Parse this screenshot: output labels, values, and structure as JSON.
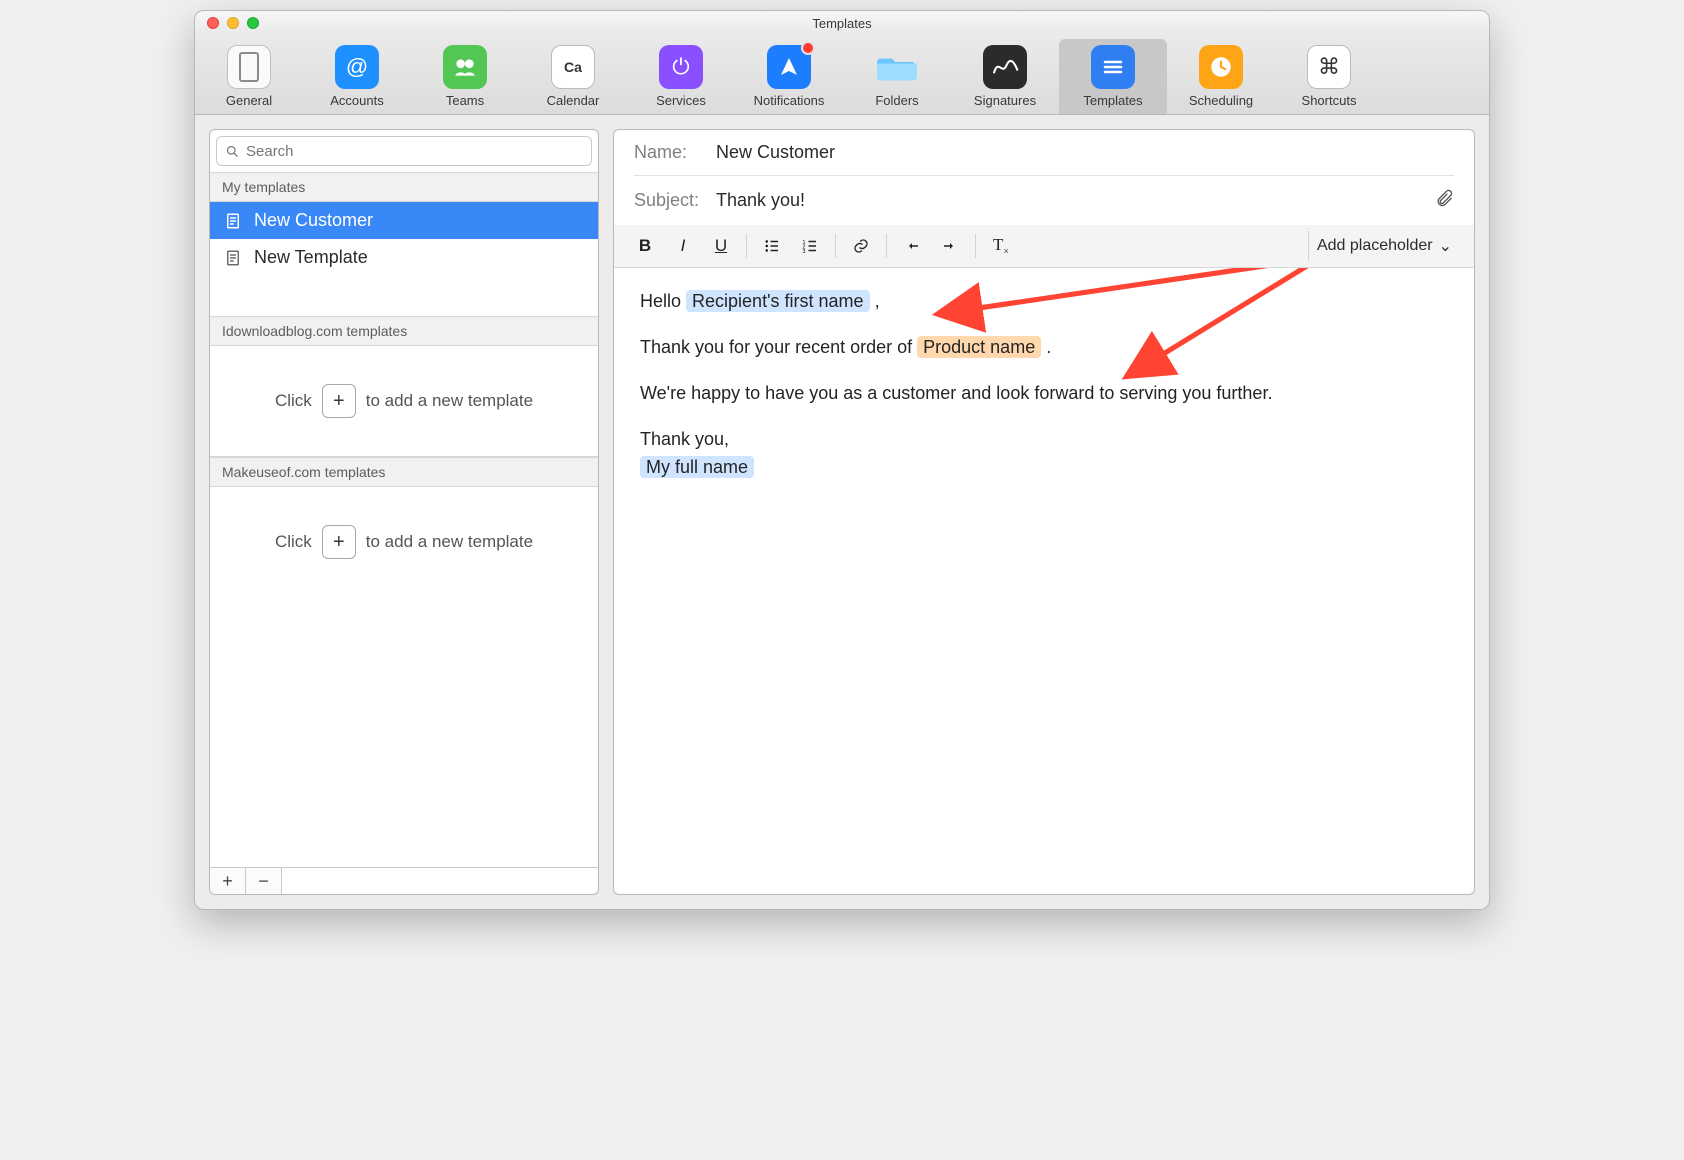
{
  "window": {
    "title": "Templates"
  },
  "toolbar": {
    "items": [
      {
        "label": "General"
      },
      {
        "label": "Accounts"
      },
      {
        "label": "Teams"
      },
      {
        "label": "Calendar",
        "inner": "Ca"
      },
      {
        "label": "Services"
      },
      {
        "label": "Notifications"
      },
      {
        "label": "Folders"
      },
      {
        "label": "Signatures"
      },
      {
        "label": "Templates"
      },
      {
        "label": "Scheduling"
      },
      {
        "label": "Shortcuts",
        "inner": "⌘"
      }
    ],
    "selected": "Templates"
  },
  "sidebar": {
    "search_placeholder": "Search",
    "sections": [
      {
        "header": "My templates",
        "items": [
          {
            "label": "New Customer",
            "selected": true
          },
          {
            "label": "New Template",
            "selected": false
          }
        ]
      },
      {
        "header": "Idownloadblog.com templates",
        "empty_prefix": "Click",
        "empty_suffix": "to add a new template"
      },
      {
        "header": "Makeuseof.com templates",
        "empty_prefix": "Click",
        "empty_suffix": "to add a new template"
      }
    ]
  },
  "editor": {
    "name_label": "Name:",
    "name_value": "New Customer",
    "subject_label": "Subject:",
    "subject_value": "Thank you!",
    "add_placeholder": "Add placeholder",
    "body": {
      "line1_pre": "Hello ",
      "line1_ph": "Recipient's first name",
      "line1_post": " ,",
      "line2_pre": "Thank you for your recent order of ",
      "line2_ph": "Product name",
      "line2_post": " .",
      "line3": "We're happy to have you as a customer and look forward to serving you further.",
      "line4": "Thank you,",
      "line5_ph": "My full name"
    }
  }
}
